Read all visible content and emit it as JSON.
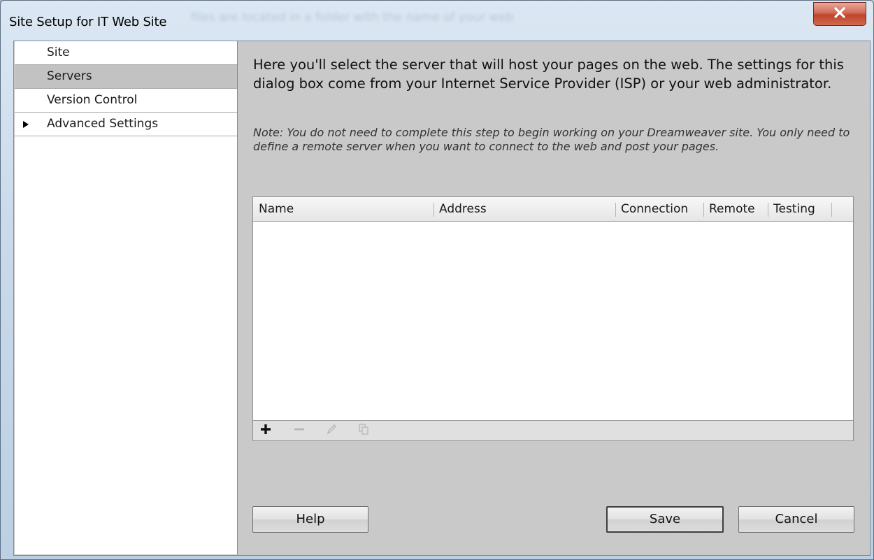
{
  "window": {
    "title": "Site Setup for IT Web Site",
    "background_title": "files are located in a folder with the name of your web",
    "close_icon": "close-icon"
  },
  "sidebar": {
    "items": [
      {
        "label": "Site",
        "selected": false,
        "expandable": false
      },
      {
        "label": "Servers",
        "selected": true,
        "expandable": false
      },
      {
        "label": "Version Control",
        "selected": false,
        "expandable": false
      },
      {
        "label": "Advanced Settings",
        "selected": false,
        "expandable": true
      }
    ]
  },
  "main": {
    "intro": "Here you'll select the server that will host your pages on the web. The settings for this dialog box come from your Internet Service Provider (ISP) or your web administrator.",
    "note": "Note: You do not need to complete this step to begin working on your Dreamweaver site. You only need to define a remote server when you want to connect to the web and post your pages.",
    "table": {
      "columns": [
        "Name",
        "Address",
        "Connection",
        "Remote",
        "Testing"
      ],
      "rows": []
    },
    "toolbar": {
      "icons": [
        "add-icon",
        "remove-icon",
        "edit-icon",
        "duplicate-icon"
      ]
    }
  },
  "buttons": {
    "help": "Help",
    "save": "Save",
    "cancel": "Cancel"
  },
  "colors": {
    "close_button": "#c9452e",
    "selected_item": "#c2c2c2",
    "panel_background": "#c9c9c9"
  }
}
